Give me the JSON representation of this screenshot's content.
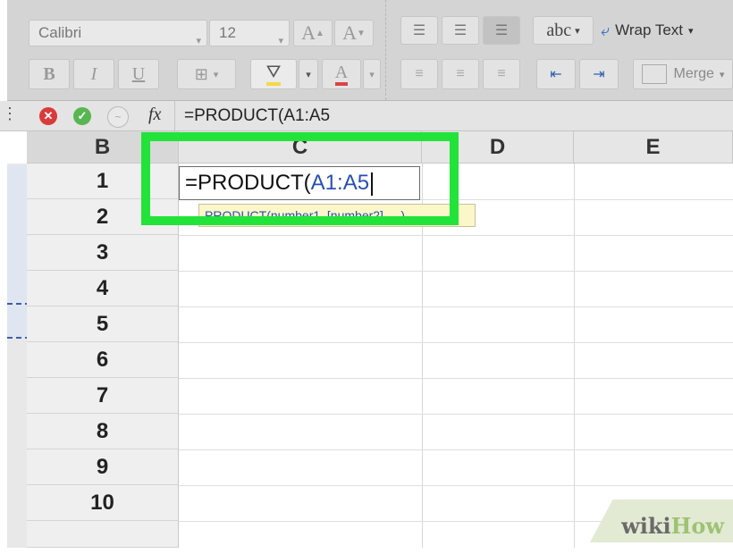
{
  "ribbon": {
    "font_name": "Calibri",
    "font_size": "12",
    "grow_font": "A",
    "shrink_font": "A",
    "bold": "B",
    "italic": "I",
    "underline": "U",
    "font_color": "A",
    "text_orientation": "abc",
    "wrap_text": "Wrap Text",
    "merge": "Merge"
  },
  "formula_bar": {
    "fx_label": "fx",
    "formula": "=PRODUCT(A1:A5"
  },
  "grid": {
    "columns": [
      "B",
      "C",
      "D",
      "E"
    ],
    "column_b_values": [
      "1",
      "2",
      "3",
      "4",
      "5",
      "6",
      "7",
      "8",
      "9",
      "10"
    ],
    "active_cell": {
      "prefix": "=PRODUCT(",
      "range": "A1:A5"
    },
    "tooltip": {
      "fn": "PRODUCT(number1, [number2], ...)"
    }
  },
  "watermark": {
    "wiki": "wiki",
    "how": "How"
  },
  "colors": {
    "highlight": "#22e339",
    "reference_blue": "#2a4fb5",
    "fill_yellow": "#f3d94b",
    "font_red": "#d64545"
  }
}
